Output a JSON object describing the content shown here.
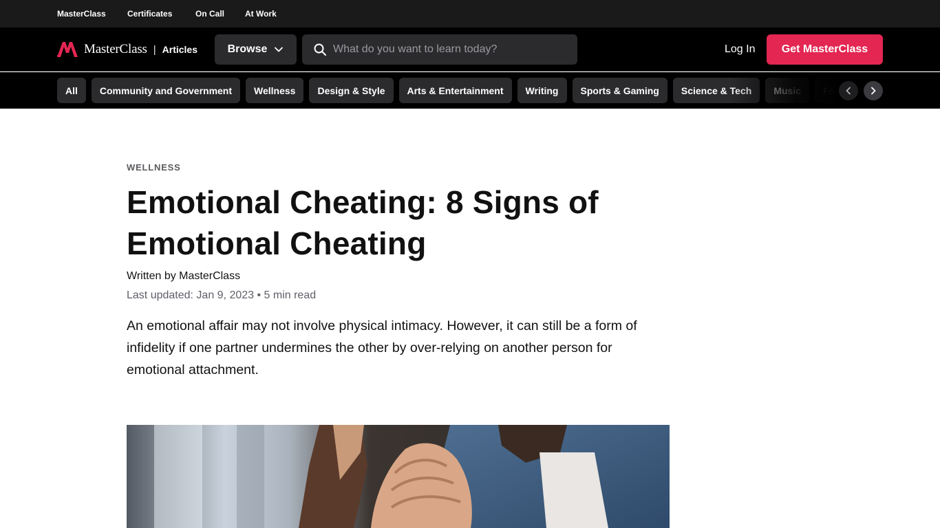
{
  "topbar": {
    "links": [
      "MasterClass",
      "Certificates",
      "On Call",
      "At Work"
    ]
  },
  "header": {
    "logo_text": "MasterClass",
    "section": "Articles",
    "browse_label": "Browse",
    "search_placeholder": "What do you want to learn today?",
    "login_label": "Log In",
    "cta_label": "Get MasterClass"
  },
  "categories": [
    "All",
    "Community and Government",
    "Wellness",
    "Design & Style",
    "Arts & Entertainment",
    "Writing",
    "Sports & Gaming",
    "Science & Tech",
    "Music",
    "Food"
  ],
  "article": {
    "eyebrow": "WELLNESS",
    "title": "Emotional Cheating: 8 Signs of Emotional Cheating",
    "byline": "Written by MasterClass",
    "updated": "Last updated: Jan 9, 2023 • 5 min read",
    "lede": "An emotional affair may not involve physical intimacy. However, it can still be a form of infidelity if one partner undermines the other by over-relying on another person for emotional attachment."
  },
  "icons": {
    "search": "search-icon",
    "browse": "chevron-down-icon",
    "prev": "chevron-left-icon",
    "next": "chevron-right-icon"
  },
  "colors": {
    "brand": "#e32652",
    "header_bg": "#000000",
    "topbar_bg": "#1a1a1a",
    "chip_bg": "#2b2b2e"
  }
}
